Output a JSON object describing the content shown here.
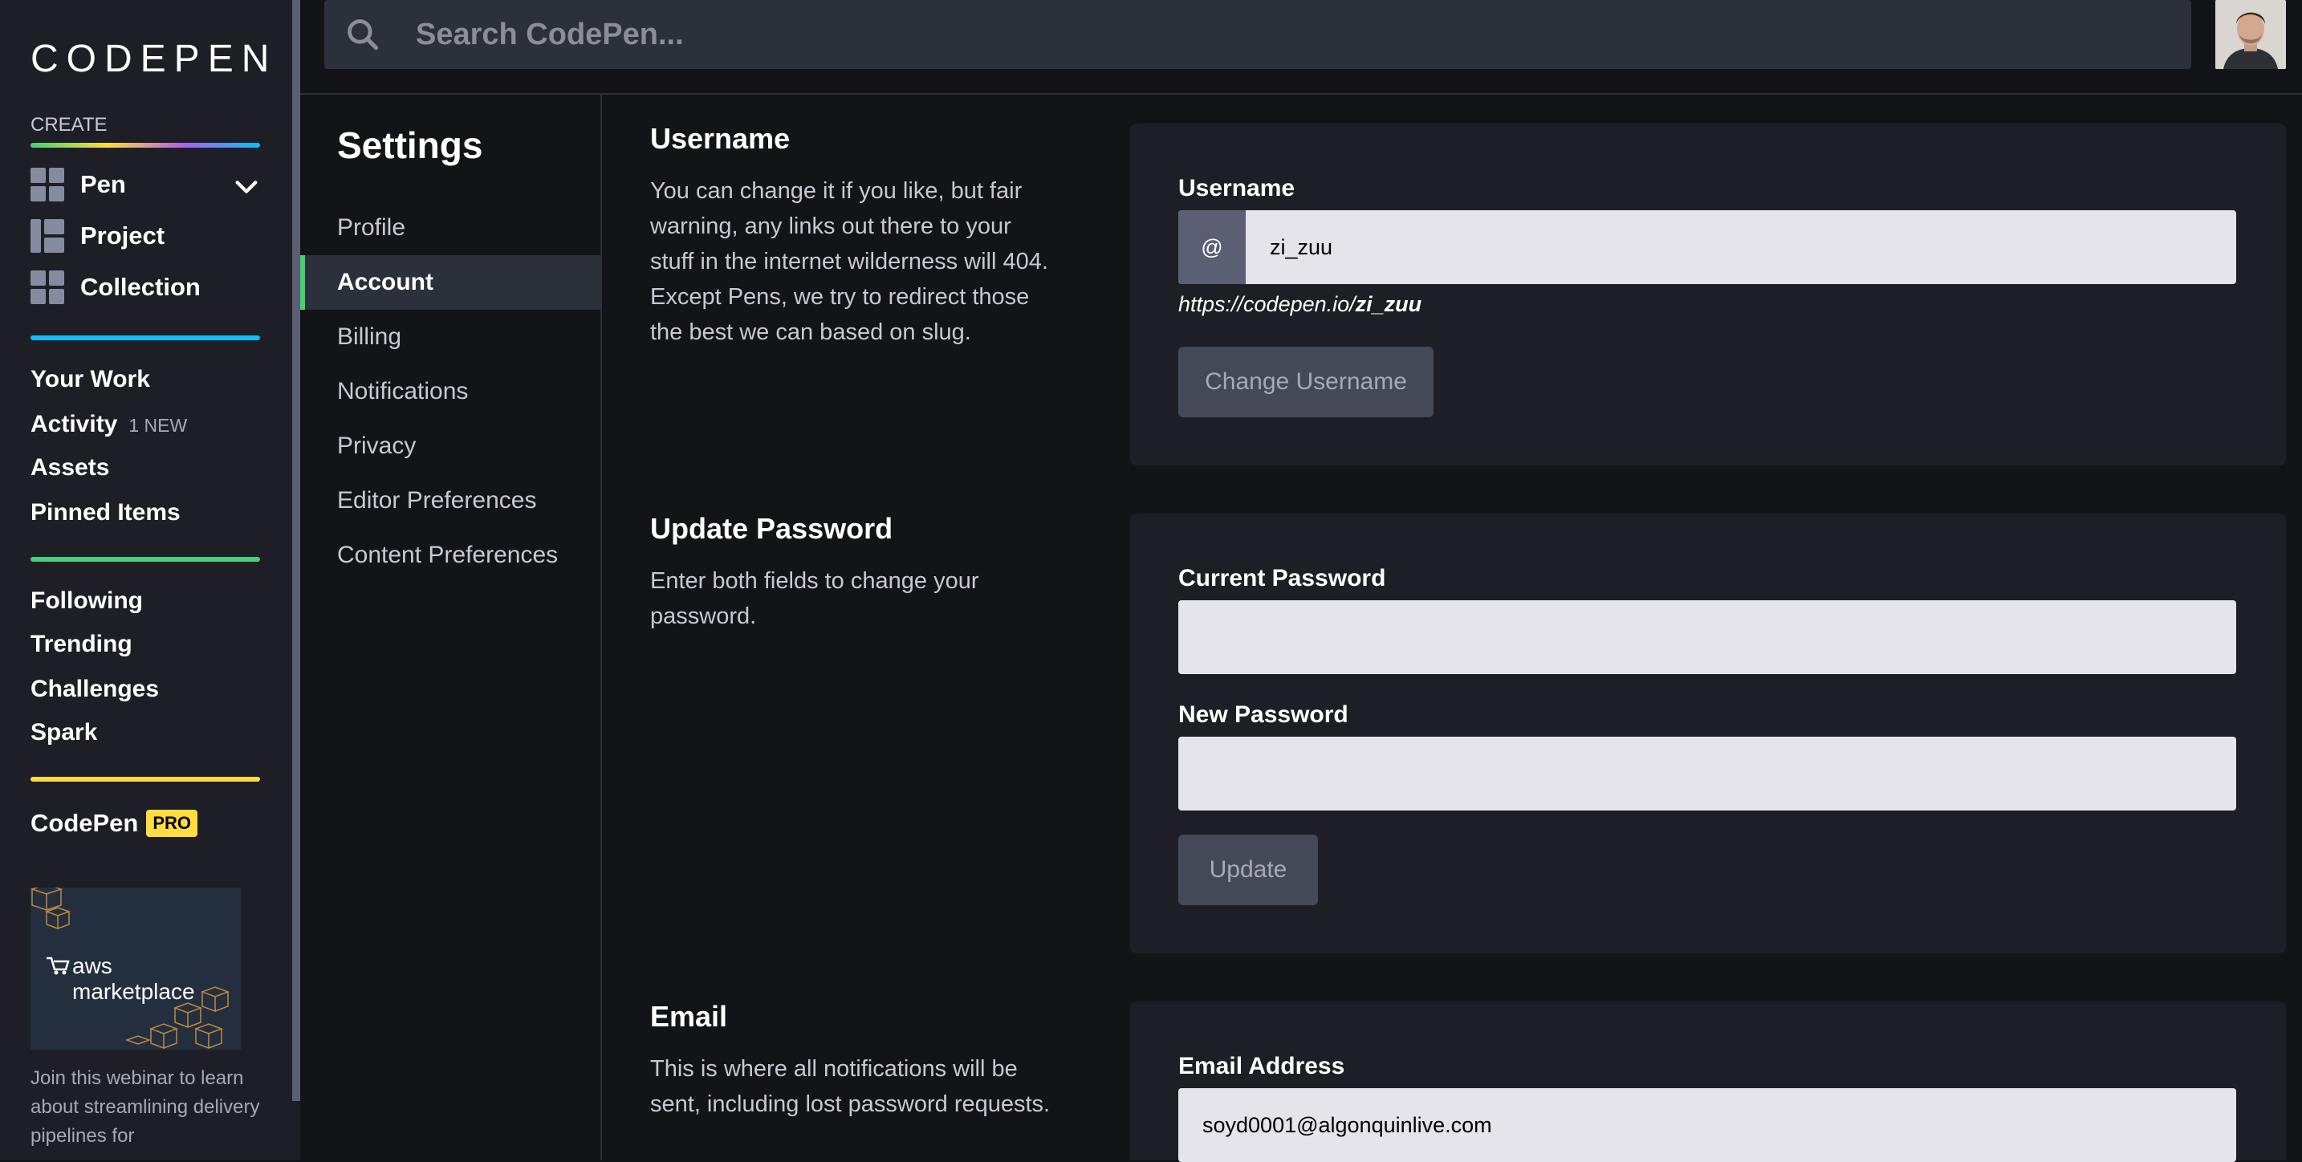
{
  "brand": {
    "logo_text": "CODEPEN"
  },
  "sidebar": {
    "create_label": "CREATE",
    "create_items": [
      {
        "label": "Pen",
        "icon": "pen-grid-icon"
      },
      {
        "label": "Project",
        "icon": "project-grid-icon"
      },
      {
        "label": "Collection",
        "icon": "collection-grid-icon"
      }
    ],
    "nav_group_1": [
      {
        "label": "Your Work"
      },
      {
        "label": "Activity",
        "badge": "1 NEW"
      },
      {
        "label": "Assets"
      },
      {
        "label": "Pinned Items"
      }
    ],
    "nav_group_2": [
      {
        "label": "Following"
      },
      {
        "label": "Trending"
      },
      {
        "label": "Challenges"
      },
      {
        "label": "Spark"
      }
    ],
    "codepen_pro": {
      "label": "CodePen",
      "badge": "PRO"
    },
    "ad": {
      "image_text": "aws marketplace",
      "text": "Join this webinar to learn about streamlining delivery pipelines for"
    },
    "divider_colors": [
      "#47cf73",
      "#ffdd40",
      "#ae63e4",
      "#0ebeff"
    ]
  },
  "header": {
    "search_placeholder": "Search CodePen..."
  },
  "settings_nav": {
    "title": "Settings",
    "items": [
      {
        "label": "Profile",
        "active": false
      },
      {
        "label": "Account",
        "active": true
      },
      {
        "label": "Billing",
        "active": false
      },
      {
        "label": "Notifications",
        "active": false
      },
      {
        "label": "Privacy",
        "active": false
      },
      {
        "label": "Editor Preferences",
        "active": false
      },
      {
        "label": "Content Preferences",
        "active": false
      }
    ]
  },
  "sections": {
    "username": {
      "title": "Username",
      "description": "You can change it if you like, but fair warning, any links out there to your stuff in the internet wilderness will 404. Except Pens, we try to redirect those the best we can based on slug.",
      "field_label": "Username",
      "prefix": "@",
      "value": "zi_zuu",
      "url_base": "https://codepen.io/",
      "url_user": "zi_zuu",
      "button": "Change Username"
    },
    "password": {
      "title": "Update Password",
      "description": "Enter both fields to change your password.",
      "current_label": "Current Password",
      "current_value": "",
      "new_label": "New Password",
      "new_value": "",
      "button": "Update"
    },
    "email": {
      "title": "Email",
      "description": "This is where all notifications will be sent, including lost password requests.",
      "field_label": "Email Address",
      "value": "soyd0001@algonquinlive.com"
    }
  },
  "colors": {
    "accent_green": "#47cf73",
    "accent_yellow": "#ffdd40",
    "accent_blue": "#0ebeff",
    "background": "#131417",
    "panel": "#1e1f26"
  }
}
